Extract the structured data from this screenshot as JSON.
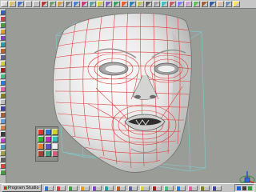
{
  "taskbar": {
    "start_label": "Program Studio"
  },
  "icons": {
    "menu": [
      "file-icon",
      "open-icon",
      "save-icon",
      "undo-icon",
      "redo-icon",
      "cut-icon",
      "copy-icon",
      "paste-icon",
      "select-icon",
      "move-icon",
      "rotate-icon",
      "scale-icon",
      "zoom-icon",
      "pan-icon",
      "orbit-icon",
      "render-icon",
      "material-icon",
      "light-icon",
      "camera-icon",
      "grid-icon",
      "snap-icon",
      "mirror-icon",
      "weld-icon",
      "extrude-icon",
      "bevel-icon",
      "smooth-icon",
      "knife-icon",
      "paint-icon",
      "uv-icon",
      "help-icon"
    ],
    "left": [
      "select-tool-icon",
      "move-tool-icon",
      "rotate-tool-icon",
      "scale-tool-icon",
      "vertex-mode-icon",
      "edge-mode-icon",
      "face-mode-icon",
      "object-mode-icon",
      "extrude-tool-icon",
      "bevel-tool-icon",
      "cut-tool-icon",
      "weld-tool-icon",
      "smooth-tool-icon",
      "sculpt-tool-icon",
      "paint-tool-icon",
      "texture-tool-icon",
      "camera-tool-icon",
      "light-tool-icon",
      "material-tool-icon",
      "render-tool-icon",
      "layer-tool-icon",
      "group-tool-icon",
      "hide-tool-icon",
      "lock-tool-icon",
      "snap-tool-icon",
      "mirror-tool-icon"
    ],
    "palette": [
      "brush-icon",
      "pencil-icon",
      "spray-icon",
      "fill-icon",
      "eraser-icon",
      "smudge-icon",
      "stamp-icon",
      "blur-icon",
      "sharpen-icon",
      "dodge-icon",
      "burn-icon",
      "color-icon"
    ],
    "taskbar": [
      "task-app-1-icon",
      "task-app-2-icon",
      "task-app-3-icon",
      "task-app-4-icon",
      "task-app-5-icon",
      "task-app-6-icon",
      "task-app-7-icon",
      "task-app-8-icon",
      "task-app-9-icon",
      "task-app-10-icon",
      "task-app-11-icon",
      "task-app-12-icon",
      "task-app-13-icon",
      "task-app-14-icon",
      "task-app-15-icon"
    ],
    "tray": [
      "network-icon",
      "volume-icon",
      "clock-icon"
    ]
  },
  "colors": {
    "viewport_bg": "#9a9c98",
    "wire": "#e03a3a",
    "bounding_box": "#7fc8c8",
    "surface": "#f4f4f4"
  }
}
